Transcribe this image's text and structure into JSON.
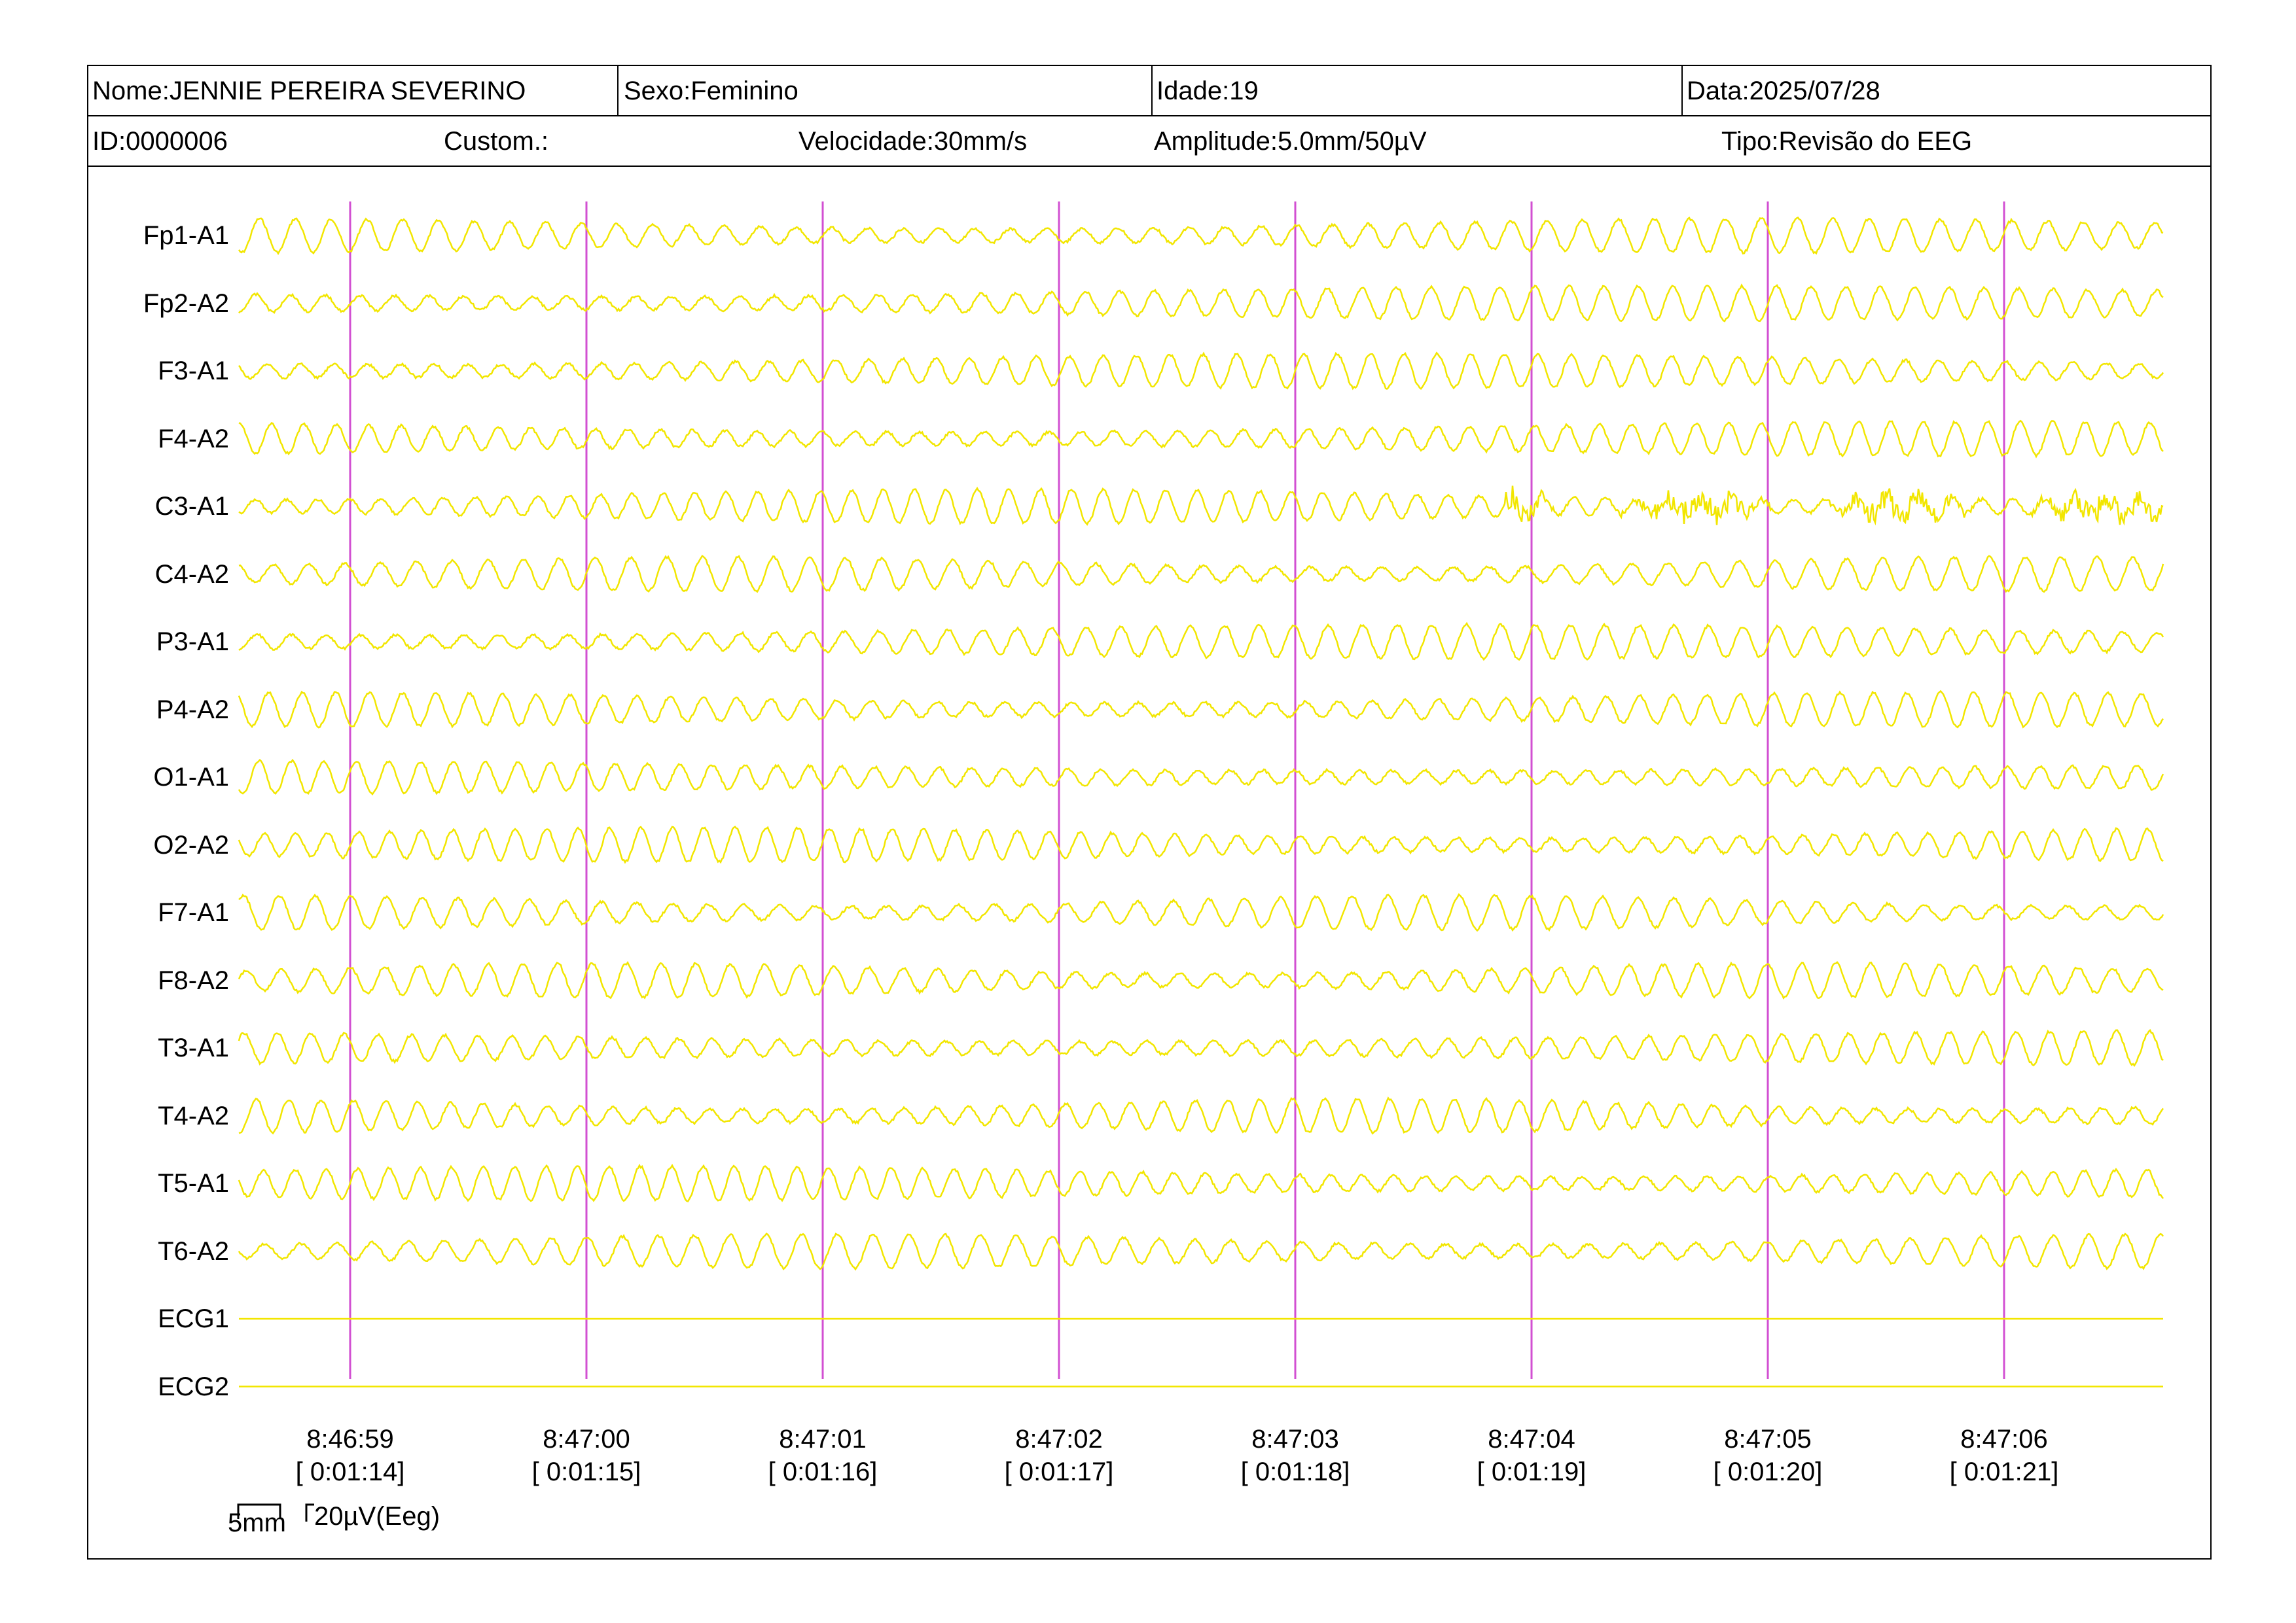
{
  "header": {
    "name": "Nome:JENNIE PEREIRA SEVERINO",
    "sex": "Sexo:Feminino",
    "age": "Idade:19",
    "date": "Data:2025/07/28",
    "id": "ID:0000006",
    "custom": "Custom.:",
    "speed": "Velocidade:30mm/s",
    "amplitude": "Amplitude:5.0mm/50µV",
    "type": "Tipo:Revisão do EEG"
  },
  "channels": [
    "Fp1-A1",
    "Fp2-A2",
    "F3-A1",
    "F4-A2",
    "C3-A1",
    "C4-A2",
    "P3-A1",
    "P4-A2",
    "O1-A1",
    "O2-A2",
    "F7-A1",
    "F8-A2",
    "T3-A1",
    "T4-A2",
    "T5-A1",
    "T6-A2",
    "ECG1",
    "ECG2"
  ],
  "time_marks": [
    {
      "clock": "8:46:59",
      "elapsed": "[ 0:01:14]"
    },
    {
      "clock": "8:47:00",
      "elapsed": "[ 0:01:15]"
    },
    {
      "clock": "8:47:01",
      "elapsed": "[ 0:01:16]"
    },
    {
      "clock": "8:47:02",
      "elapsed": "[ 0:01:17]"
    },
    {
      "clock": "8:47:03",
      "elapsed": "[ 0:01:18]"
    },
    {
      "clock": "8:47:04",
      "elapsed": "[ 0:01:19]"
    },
    {
      "clock": "8:47:05",
      "elapsed": "[ 0:01:20]"
    },
    {
      "clock": "8:47:06",
      "elapsed": "[ 0:01:21]"
    }
  ],
  "scale": {
    "time_bar": "5mm",
    "amp_bar": "20µV(Eeg)"
  },
  "colors": {
    "trace": "#f2e600",
    "marker": "#d24fd2",
    "border": "#000000",
    "background": "#ffffff"
  }
}
